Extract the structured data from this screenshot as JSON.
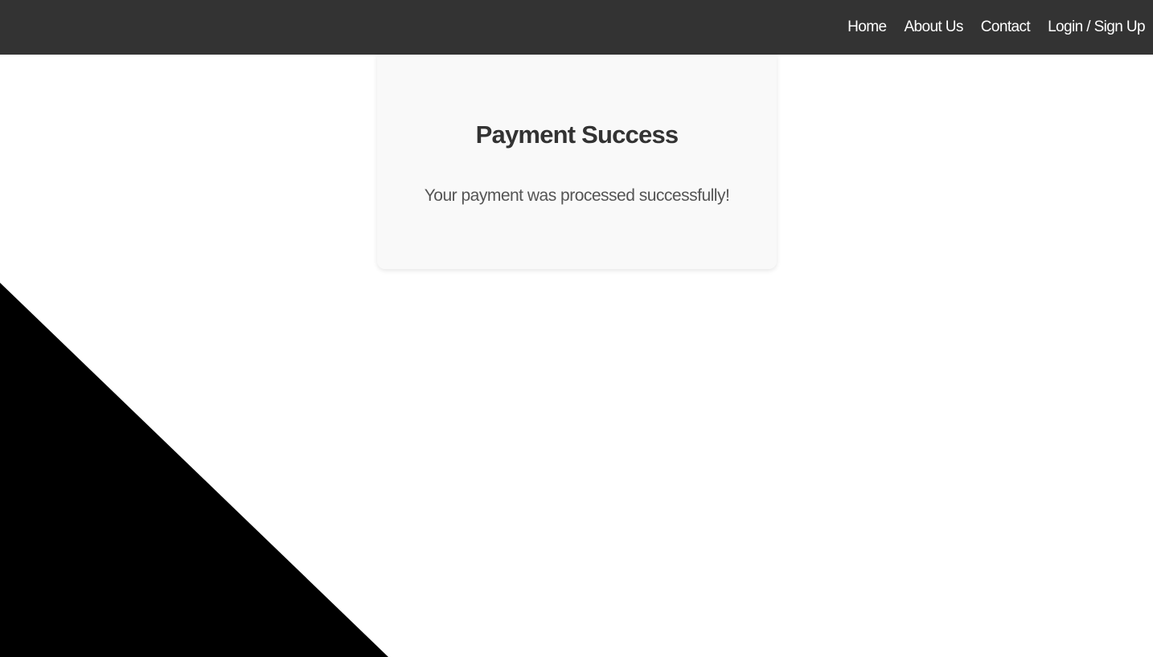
{
  "nav": {
    "items": [
      {
        "label": "Home"
      },
      {
        "label": "About Us"
      },
      {
        "label": "Contact"
      },
      {
        "label": "Login / Sign Up"
      }
    ]
  },
  "main": {
    "title": "Payment Success",
    "message": "Your payment was processed successfully!"
  },
  "colors": {
    "header_bg": "#333333",
    "card_bg": "#f9f9f9",
    "shape": "#000000"
  }
}
